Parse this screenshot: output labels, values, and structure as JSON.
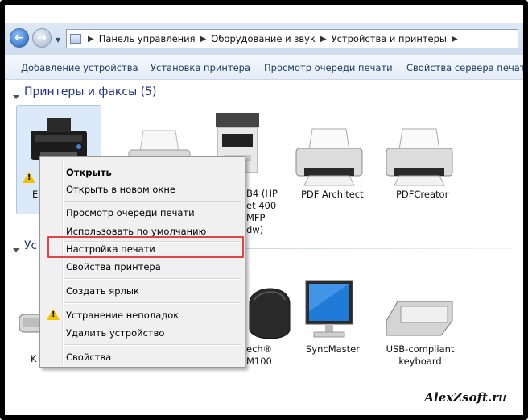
{
  "address_bar": {
    "crumbs": [
      "Панель управления",
      "Оборудование и звук",
      "Устройства и принтеры"
    ]
  },
  "toolbar": {
    "add_device": "Добавление устройства",
    "install_printer": "Установка принтера",
    "view_queue": "Просмотр очереди печати",
    "server_properties": "Свойства сервера печати"
  },
  "printers_group": {
    "title": "Принтеры и факсы (5)",
    "items": [
      {
        "label": "E",
        "icon": "printer-inkjet-warning-icon"
      },
      {
        "label": "",
        "icon": "printer-icon"
      },
      {
        "label": "...B4 (HP ...et 400 ...MFP ...dw)",
        "icon": "mfp-printer-icon"
      },
      {
        "label": "PDF Architect",
        "icon": "printer-icon"
      },
      {
        "label": "PDFCreator",
        "icon": "printer-icon"
      }
    ],
    "hp_lines": [
      "B4 (HP",
      "et 400",
      "MFP",
      "dw)"
    ]
  },
  "devices_group": {
    "title_fragment": "Уст",
    "items": [
      {
        "label": "K",
        "icon": "keyboard-icon"
      },
      {
        "label_lines": [
          "ech®",
          "M100"
        ],
        "icon": "mouse-icon"
      },
      {
        "label": "SyncMaster",
        "icon": "monitor-icon"
      },
      {
        "label_lines": [
          "USB-compliant",
          "keyboard"
        ],
        "icon": "keyboard-icon"
      }
    ]
  },
  "context_menu": {
    "open": "Открыть",
    "open_new_window": "Открыть в новом окне",
    "view_queue": "Просмотр очереди печати",
    "set_default": "Использовать по умолчанию",
    "print_settings": "Настройка печати",
    "printer_properties": "Свойства принтера",
    "create_shortcut": "Создать ярлык",
    "troubleshoot": "Устранение неполадок",
    "remove_device": "Удалить устройство",
    "properties": "Свойства"
  },
  "watermark": "AlexZsoft.ru",
  "colors": {
    "highlight_box": "#e04444",
    "group_title": "#1e3287",
    "warning": "#f2c200"
  }
}
